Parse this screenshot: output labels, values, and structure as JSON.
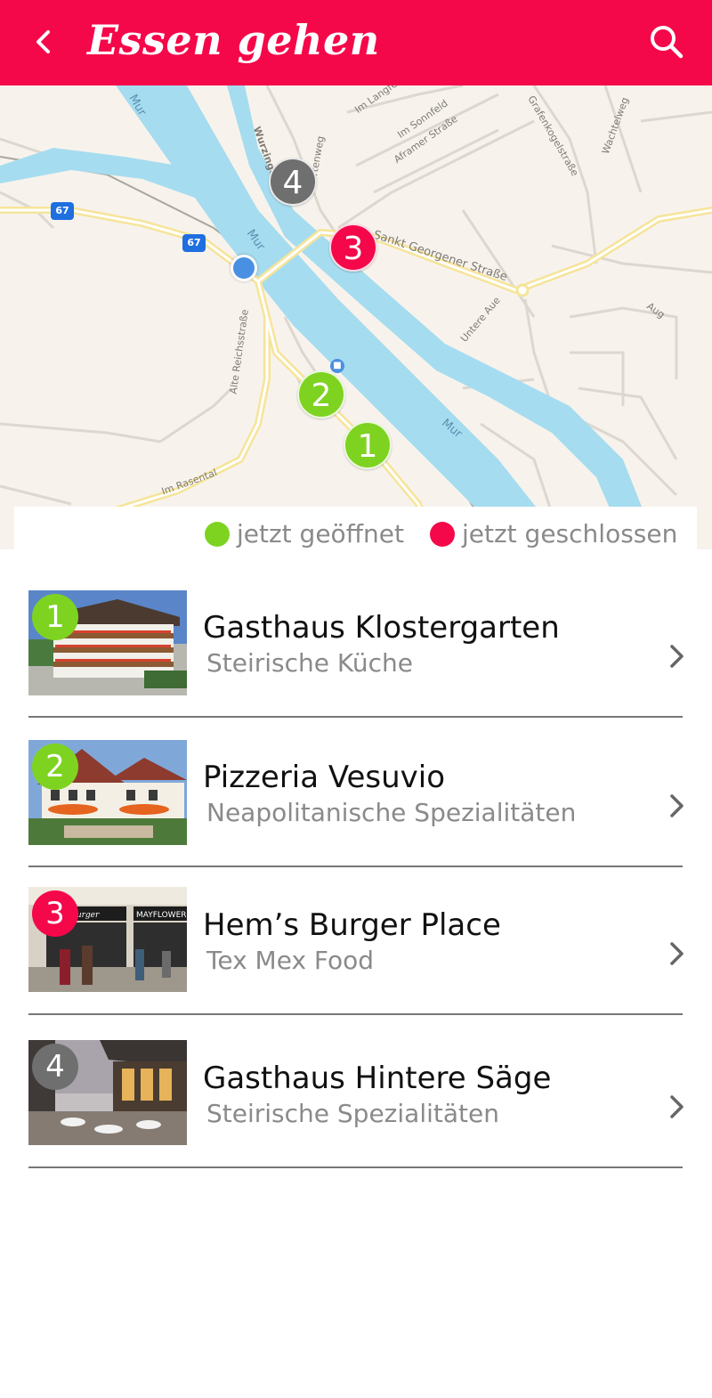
{
  "header": {
    "title": "Essen gehen",
    "background_color": "#f4084a",
    "back_icon": "chevron-left-icon",
    "search_icon": "search-icon"
  },
  "map": {
    "streets": [
      "Im Langfeld",
      "Im Sonnfeld",
      "Aframer Straße",
      "Grafenkogelstraße",
      "Wachtelweg",
      "Wurzinger",
      "Gartenweg",
      "Sankt Georgener Straße",
      "Untere Aue",
      "Aug",
      "Alte Reichsstraße",
      "Im Rasental"
    ],
    "river_name": "Mur",
    "road_shield": "67",
    "pins": [
      {
        "number": "4",
        "status": "neutral"
      },
      {
        "number": "3",
        "status": "closed"
      },
      {
        "number": "2",
        "status": "open"
      },
      {
        "number": "1",
        "status": "open"
      }
    ]
  },
  "legend": {
    "open_label": "jetzt geöffnet",
    "closed_label": "jetzt geschlossen",
    "open_color": "#7ed321",
    "closed_color": "#f4084a"
  },
  "restaurants": [
    {
      "number": "1",
      "name": "Gasthaus Klostergarten",
      "subtitle": "Steirische Küche",
      "status": "open"
    },
    {
      "number": "2",
      "name": "Pizzeria Vesuvio",
      "subtitle": "Neapolitanische Spezialitäten",
      "status": "open"
    },
    {
      "number": "3",
      "name": "Hem’s Burger Place",
      "subtitle": "Tex Mex Food",
      "status": "closed"
    },
    {
      "number": "4",
      "name": "Gasthaus Hintere Säge",
      "subtitle": "Steirische Spezialitäten",
      "status": "neutral"
    }
  ],
  "photo_signs": {
    "burger_sign": "Joe Burger",
    "mayflower_sign": "MAYFLOWER"
  }
}
